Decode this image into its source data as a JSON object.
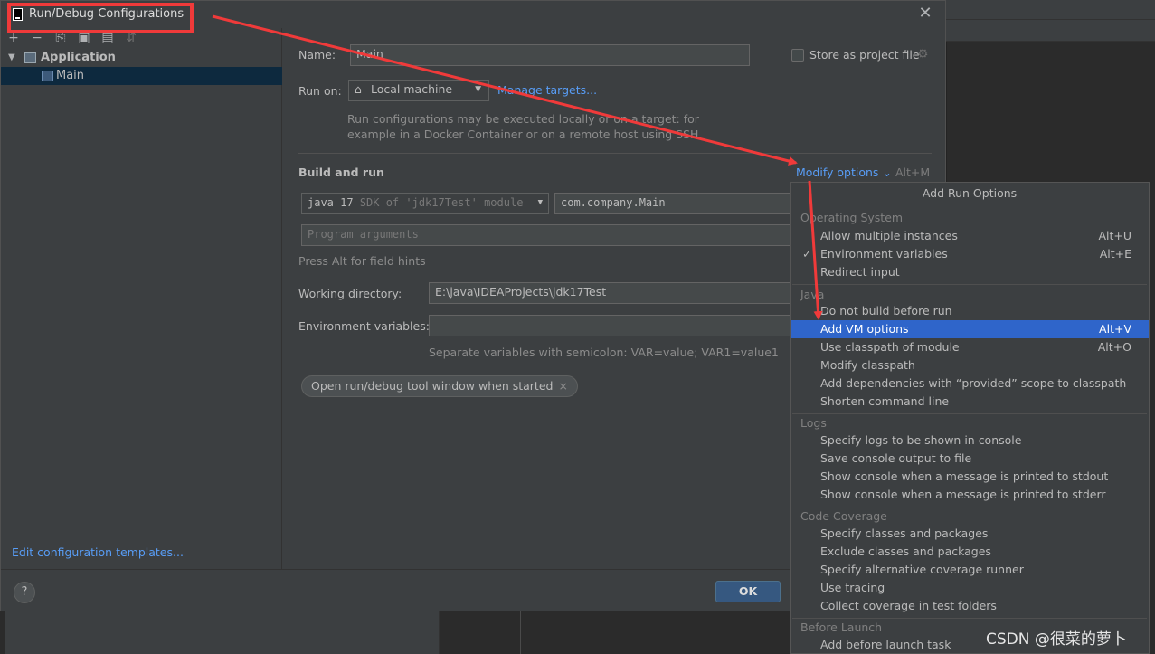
{
  "dialog": {
    "title": "Run/Debug Configurations",
    "close_glyph": "✕"
  },
  "toolbar": {
    "add": "+",
    "remove": "−",
    "copy": "⎘",
    "save": "▣",
    "folder": "▤",
    "sort": "⇵"
  },
  "tree": {
    "group_label": "Application",
    "item_label": "Main",
    "edit_templates": "Edit configuration templates..."
  },
  "form": {
    "name_label": "Name:",
    "name_value": "Main",
    "store_label": "Store as project file",
    "run_on_label": "Run on:",
    "run_on_value": "Local machine",
    "manage_targets": "Manage targets...",
    "run_on_hint_1": "Run configurations may be executed locally or on a target: for",
    "run_on_hint_2": "example in a Docker Container or on a remote host using SSH.",
    "build_run_title": "Build and run",
    "modify_options": "Modify options",
    "modify_shortcut": "Alt+M",
    "jdk_main": "java 17",
    "jdk_detail": "SDK of 'jdk17Test' module",
    "main_class": "com.company.Main",
    "program_args_placeholder": "Program arguments",
    "alt_hint": "Press Alt for field hints",
    "workdir_label": "Working directory:",
    "workdir_value": "E:\\java\\IDEAProjects\\jdk17Test",
    "env_label": "Environment variables:",
    "env_value": "",
    "env_hint": "Separate variables with semicolon: VAR=value; VAR1=value1",
    "chip_label": "Open run/debug tool window when started",
    "chip_x": "×"
  },
  "buttons": {
    "help": "?",
    "ok": "OK"
  },
  "popup": {
    "header": "Add Run Options",
    "groups": {
      "os": "Operating System",
      "java": "Java",
      "logs": "Logs",
      "coverage": "Code Coverage",
      "before": "Before Launch"
    },
    "os_items": [
      {
        "label": "Allow multiple instances",
        "shortcut": "Alt+U",
        "check": ""
      },
      {
        "label": "Environment variables",
        "shortcut": "Alt+E",
        "check": "✓"
      },
      {
        "label": "Redirect input",
        "shortcut": "",
        "check": ""
      }
    ],
    "java_items": [
      {
        "label": "Do not build before run",
        "shortcut": ""
      },
      {
        "label": "Add VM options",
        "shortcut": "Alt+V"
      },
      {
        "label": "Use classpath of module",
        "shortcut": "Alt+O"
      },
      {
        "label": "Modify classpath",
        "shortcut": ""
      },
      {
        "label": "Add dependencies with “provided” scope to classpath",
        "shortcut": ""
      },
      {
        "label": "Shorten command line",
        "shortcut": ""
      }
    ],
    "logs_items": [
      {
        "label": "Specify logs to be shown in console"
      },
      {
        "label": "Save console output to file"
      },
      {
        "label": "Show console when a message is printed to stdout"
      },
      {
        "label": "Show console when a message is printed to stderr"
      }
    ],
    "coverage_items": [
      {
        "label": "Specify classes and packages"
      },
      {
        "label": "Exclude classes and packages"
      },
      {
        "label": "Specify alternative coverage runner"
      },
      {
        "label": "Use tracing"
      },
      {
        "label": "Collect coverage in test folders"
      }
    ],
    "before_items": [
      {
        "label": "Add before launch task"
      }
    ]
  },
  "watermark": "CSDN @很菜的萝卜",
  "colors": {
    "annotation_red": "#f03a3a",
    "link": "#589df6",
    "selection": "#2f65ca",
    "ok_button": "#365880"
  }
}
